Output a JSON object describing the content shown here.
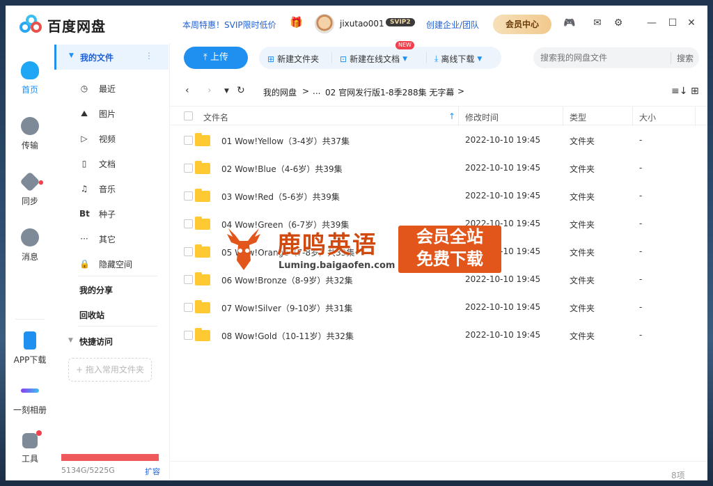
{
  "app": {
    "name": "百度网盘",
    "promo": "本周特惠！SVIP限时低价",
    "username": "jixutao001",
    "svip_badge": "SVIP2",
    "enterprise": "创建企业/团队",
    "vip_center": "会员中心"
  },
  "rail": {
    "home": "首页",
    "transfer": "传输",
    "sync": "同步",
    "message": "消息",
    "app_download": "APP下载",
    "album": "一刻相册",
    "tools": "工具"
  },
  "sidebar": {
    "my_files": "我的文件",
    "items": [
      "最近",
      "图片",
      "视频",
      "文档",
      "音乐",
      "种子",
      "其它",
      "隐藏空间"
    ],
    "my_share": "我的分享",
    "recycle": "回收站",
    "quick_access": "快捷访问",
    "drop_hint": "+ 拖入常用文件夹",
    "storage_text": "5134G/5225G",
    "storage_fraction": 0.983,
    "expand": "扩容"
  },
  "toolbar": {
    "upload": "上传",
    "new_folder": "新建文件夹",
    "new_doc": "新建在线文档",
    "new_badge": "NEW",
    "offline": "离线下载",
    "search_placeholder": "搜索我的网盘文件",
    "search_btn": "搜索"
  },
  "breadcrumb": {
    "root": "我的网盘",
    "sep": ">",
    "ellipsis": "...",
    "current": "02 官网发行版1-8季288集 无字幕"
  },
  "table": {
    "headers": [
      "文件名",
      "修改时间",
      "类型",
      "大小"
    ],
    "rows": [
      {
        "name": "01 Wow!Yellow（3-4岁）共37集",
        "time": "2022-10-10 19:45",
        "type": "文件夹",
        "size": "-"
      },
      {
        "name": "02 Wow!Blue（4-6岁）共39集",
        "time": "2022-10-10 19:45",
        "type": "文件夹",
        "size": "-"
      },
      {
        "name": "03 Wow!Red（5-6岁）共39集",
        "time": "2022-10-10 19:45",
        "type": "文件夹",
        "size": "-"
      },
      {
        "name": "04 Wow!Green（6-7岁）共39集",
        "time": "2022-10-10 19:45",
        "type": "文件夹",
        "size": "-"
      },
      {
        "name": "05 Wow!Orange（7-8岁）共33集",
        "time": "2022-10-10 19:45",
        "type": "文件夹",
        "size": "-"
      },
      {
        "name": "06 Wow!Bronze（8-9岁）共32集",
        "time": "2022-10-10 19:45",
        "type": "文件夹",
        "size": "-"
      },
      {
        "name": "07 Wow!Silver（9-10岁）共31集",
        "time": "2022-10-10 19:45",
        "type": "文件夹",
        "size": "-"
      },
      {
        "name": "08 Wow!Gold（10-11岁）共32集",
        "time": "2022-10-10 19:45",
        "type": "文件夹",
        "size": "-"
      }
    ],
    "count": "8项"
  },
  "watermark": {
    "title": "鹿鸣英语",
    "url": "Luming.baigaofen.com",
    "box_line1": "会员全站",
    "box_line2": "免费下载"
  },
  "colors": {
    "accent": "#1f8ff0",
    "link": "#1f5fd8",
    "folder": "#ffc933",
    "storage": "#f0595b",
    "watermark": "#e2561b"
  }
}
